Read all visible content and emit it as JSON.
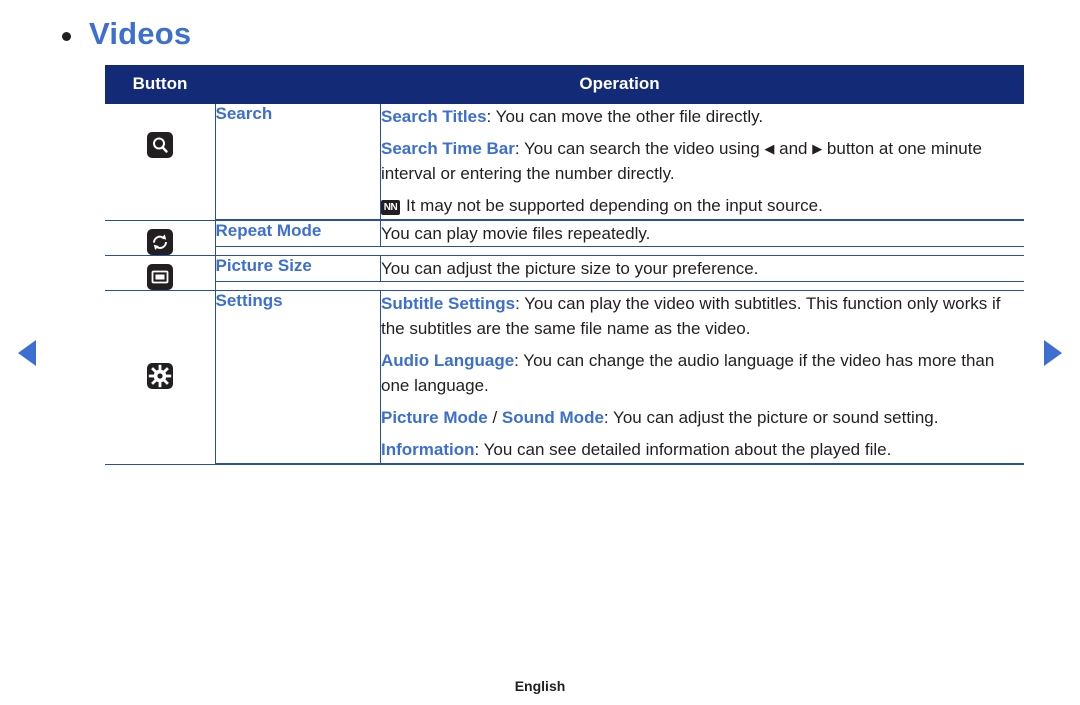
{
  "page": {
    "title": "Videos",
    "footer": "English"
  },
  "nav": {
    "prev_icon": "triangle-left-icon",
    "next_icon": "triangle-right-icon"
  },
  "table": {
    "headers": {
      "button": "Button",
      "operation": "Operation"
    },
    "rows": [
      {
        "icon": "search-icon",
        "label": "Search",
        "paragraphs": [
          {
            "segments": [
              {
                "text": "Search Titles",
                "style": "highlight"
              },
              {
                "text": ": You can move the other file directly.",
                "style": "normal"
              }
            ]
          },
          {
            "segments": [
              {
                "text": "Search Time Bar",
                "style": "highlight"
              },
              {
                "text": ": You can search the video using ",
                "style": "normal"
              },
              {
                "text": "◀",
                "style": "glyph"
              },
              {
                "text": " and ",
                "style": "normal"
              },
              {
                "text": "▶",
                "style": "glyph"
              },
              {
                "text": " button at one minute interval or entering the number directly.",
                "style": "normal"
              }
            ]
          },
          {
            "note": "NN",
            "segments": [
              {
                "text": "It may not be supported depending on the input source.",
                "style": "normal"
              }
            ]
          }
        ]
      },
      {
        "icon": "repeat-icon",
        "label": "Repeat Mode",
        "paragraphs": [
          {
            "segments": [
              {
                "text": "You can play movie files repeatedly.",
                "style": "normal"
              }
            ]
          }
        ]
      },
      {
        "icon": "picture-size-icon",
        "label": "Picture Size",
        "paragraphs": [
          {
            "segments": [
              {
                "text": "You can adjust the picture size to your preference.",
                "style": "normal"
              }
            ]
          }
        ]
      },
      {
        "icon": "settings-gear-icon",
        "label": "Settings",
        "paragraphs": [
          {
            "segments": [
              {
                "text": "Subtitle Settings",
                "style": "highlight"
              },
              {
                "text": ": You can play the video with subtitles. This function only works if the subtitles are the same file name as the video.",
                "style": "normal"
              }
            ]
          },
          {
            "segments": [
              {
                "text": "Audio Language",
                "style": "highlight"
              },
              {
                "text": ": You can change the audio language if the video has more than one language.",
                "style": "normal"
              }
            ]
          },
          {
            "segments": [
              {
                "text": "Picture Mode",
                "style": "highlight"
              },
              {
                "text": " / ",
                "style": "normal"
              },
              {
                "text": "Sound Mode",
                "style": "highlight"
              },
              {
                "text": ": You can adjust the picture or sound setting.",
                "style": "normal"
              }
            ]
          },
          {
            "segments": [
              {
                "text": "Information",
                "style": "highlight"
              },
              {
                "text": ": You can see detailed information about the played file.",
                "style": "normal"
              }
            ]
          }
        ]
      }
    ]
  }
}
